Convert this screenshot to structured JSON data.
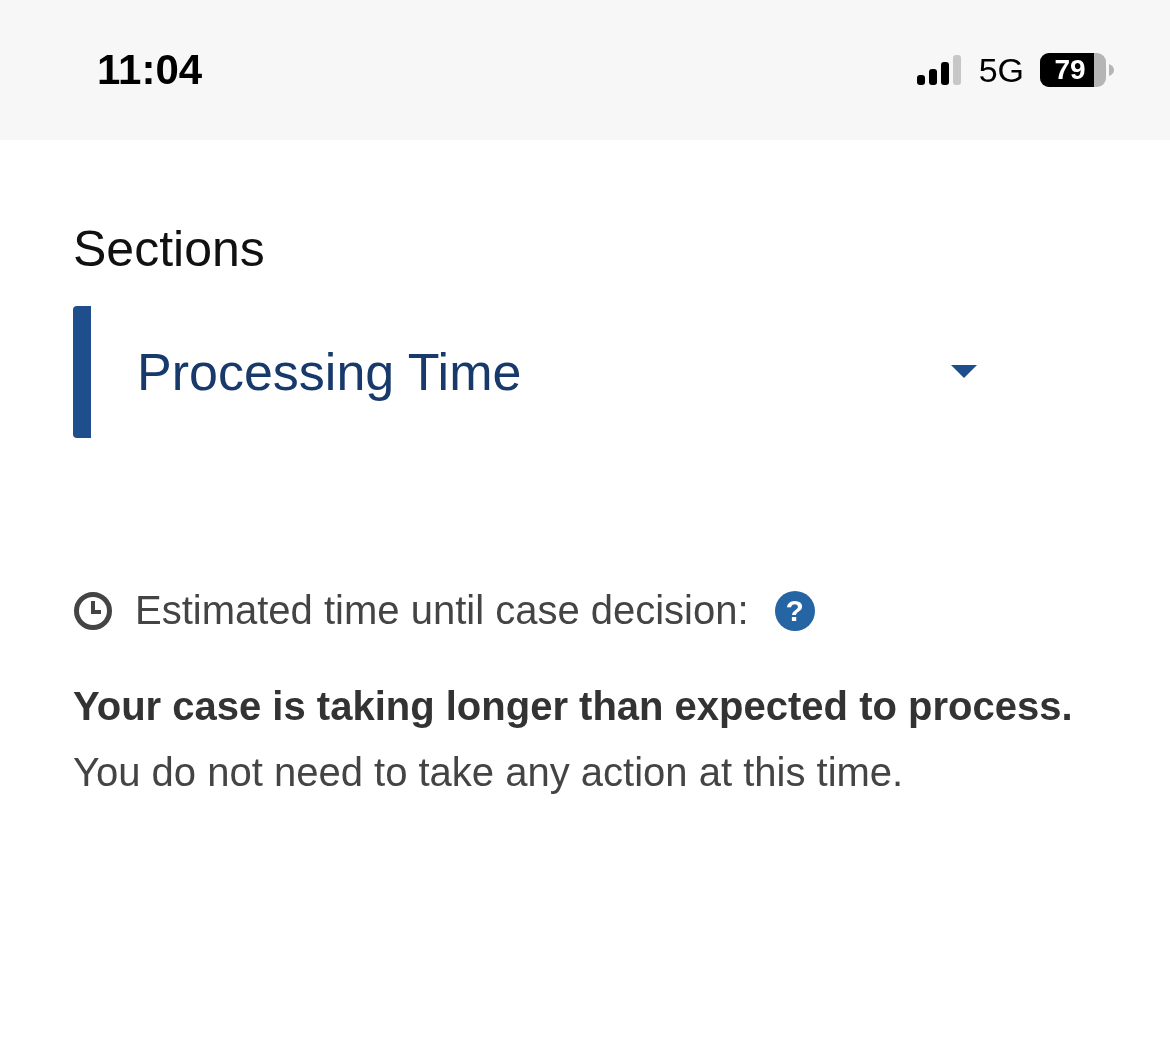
{
  "status_bar": {
    "time": "11:04",
    "network": "5G",
    "battery": "79"
  },
  "sections": {
    "heading": "Sections",
    "selected_section": "Processing Time"
  },
  "estimate": {
    "label": "Estimated time until case decision:",
    "help": "?"
  },
  "message": "**Your case is taking longer than expected to process.** You do not need to take any action at this time."
}
